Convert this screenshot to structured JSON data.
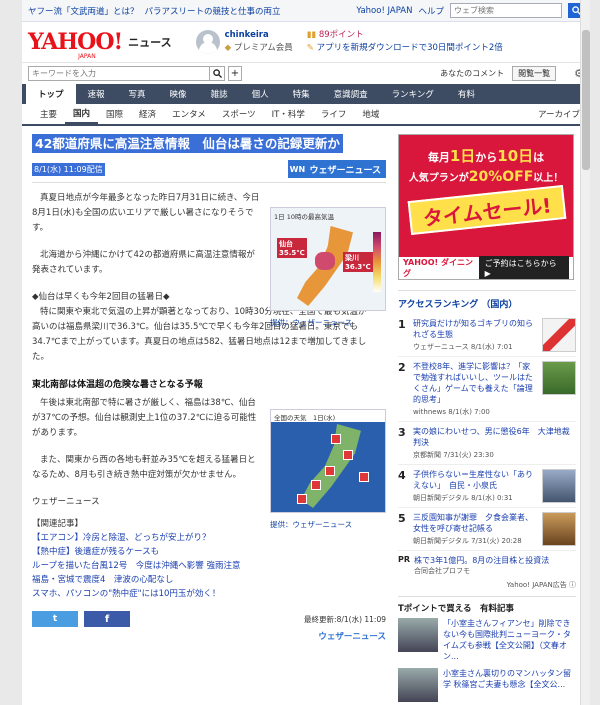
{
  "utilbar": {
    "links": [
      "ヤフー流「文武両道」とは？",
      "パラアスリートの競技と仕事の両立"
    ],
    "yahoo_japan": "Yahoo! JAPAN",
    "help": "ヘルプ",
    "search_placeholder": "ウェブ検索"
  },
  "header": {
    "logo": "YAHOO!",
    "logo_sub": "JAPAN",
    "service": "ニュース",
    "user_name": "chinkeira",
    "premium": "プレミアム会員",
    "points": "89ポイント",
    "promo": "アプリを新規ダウンロードで30日間ポイント2倍"
  },
  "searchbar": {
    "placeholder": "キーワードを入力",
    "your_comments": "あなたのコメント",
    "browse_history": "閲覧一覧"
  },
  "mainnav": [
    "トップ",
    "速報",
    "写真",
    "映像",
    "雑誌",
    "個人",
    "特集",
    "意識調査",
    "ランキング",
    "有料"
  ],
  "subnav": [
    "主要",
    "国内",
    "国際",
    "経済",
    "エンタメ",
    "スポーツ",
    "IT・科学",
    "ライフ",
    "地域"
  ],
  "archive": "アーカイブ",
  "article": {
    "headline": "42都道府県に高温注意情報　仙台は暑さの記録更新か",
    "date": "8/1(水) 11:09配信",
    "publisher_mark": "WN",
    "publisher": "ウェザーニュース",
    "p1": "真夏日地点が今年最多となった昨日7月31日に続き、今日8月1日(水)も全国の広いエリアで厳しい暑さになりそうです。",
    "p2": "北海道から沖縄にかけて42の都道府県に高温注意情報が発表されています。",
    "p3_title": "◆仙台は早くも今年2回目の猛暑日◆",
    "p3": "特に関東や東北で気温の上昇が顕著となっており、10時30分現在、全国で最も気温が高いのは福島県梁川で36.3℃。仙台は35.5℃で早くも今年2回目の猛暑日。東京でも34.7℃まで上がっています。真夏日の地点は582、猛暑日地点は12まで増加してきました。",
    "section2": "東北南部は体温超の危険な暑さとなる予報",
    "p4": "午後は東北南部で特に暑さが厳しく、福島は38℃、仙台が37℃の予想。仙台は観測史上1位の37.2℃に迫る可能性があります。",
    "p5": "また、関東から西の各地も軒並み35℃を超える猛暑日となるため、8月も引き続き熱中症対策が欠かせません。",
    "fig1": {
      "title": "1日 10時の最高気温",
      "label_a": "仙台",
      "value_a": "35.5℃",
      "label_b": "梁川",
      "value_b": "36.3℃",
      "caption": "提供：ウェザーニュース"
    },
    "fig2": {
      "header": "全国の天気　1日(水)",
      "caption": "提供：ウェザーニュース"
    },
    "source": "ウェザーニュース",
    "related_heading": "【関連記事】",
    "related": [
      "【エアコン】冷房と除湿、どっちが安上がり？",
      "【熱中症】後遺症が残るケースも",
      "ループを描いた台風12号　今度は沖縄へ影響 強雨注意",
      "福島・宮城で震度4　津波の心配なし",
      "スマホ、パソコンの\"熱中症\"には10円玉が効く！"
    ],
    "tw": "t",
    "fb": "f",
    "updated": "最終更新:8/1(水) 11:09",
    "wn_footer": "ウェザーニュース"
  },
  "sidebar": {
    "ad": {
      "line1_a": "毎月",
      "line1_big1": "1日",
      "line1_b": "から",
      "line1_big2": "10日",
      "line1_c": "は",
      "line2_a": "人気プランが",
      "line2_big": "20%OFF",
      "line2_b": "以上！",
      "sale": "タイムセール!",
      "brand": "YAHOO! ダイニング",
      "cta": "ご予約はこちらから ▶"
    },
    "ranking_heading": "アクセスランキング （国内）",
    "ranking": [
      {
        "num": "1",
        "title": "研究員だけが知るゴキブリの知られざる生態",
        "src": "ウェザーニュース 8/1(水) 7:01"
      },
      {
        "num": "2",
        "title": "不登校8年、進学に影響は？「家で勉強すればいいし、ツールはたくさん」ゲームでも養えた「論理的思考」",
        "src": "withnews 8/1(水) 7:00"
      },
      {
        "num": "3",
        "title": "実の娘にわいせつ、男に懲役6年　大津地裁判決",
        "src": "京都新聞 7/31(火) 23:30"
      },
      {
        "num": "4",
        "title": "子供作らない＝生産性ない「ありえない」　自民・小泉氏",
        "src": "朝日新聞デジタル 8/1(水) 0:31"
      },
      {
        "num": "5",
        "title": "三反園知事が謝罪　夕食会業者、女性を呼び寄せ記帳る",
        "src": "朝日新聞デジタル 7/31(火) 20:28"
      }
    ],
    "pr_tag": "PR",
    "pr_title": "株で3年1億円。8月の注目株と投資法",
    "pr_src": "合同会社プロフモ",
    "ad_credit": "Yahoo! JAPAN広告 ⓘ",
    "tpoint_heading": "Tポイントで買える　有料記事",
    "tpoint": [
      "「小室圭さんフィアンセ」削除できない今も国際批判ニューヨーク・タイムズも参戦【全文公開】（文春オン...",
      "小室圭さん裏切りのマンハッタン留学 秋篠宮ご夫妻も懸念【全文公..."
    ]
  }
}
